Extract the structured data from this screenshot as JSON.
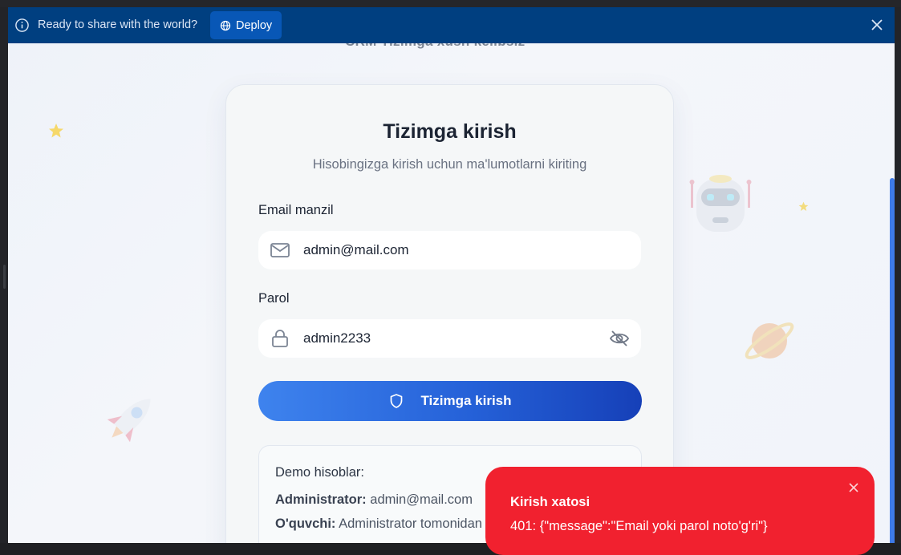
{
  "banner": {
    "text": "Ready to share with the world?",
    "deploy_label": "Deploy",
    "info_icon": "info-icon",
    "close_icon": "close-icon",
    "color": "#003f80"
  },
  "page": {
    "cut_title": "CRM Tizimga xush kelibsiz"
  },
  "login": {
    "title": "Tizimga kirish",
    "subtitle": "Hisobingizga kirish uchun ma'lumotlarni kiriting",
    "email_label": "Email manzil",
    "email_value": "admin@mail.com",
    "password_label": "Parol",
    "password_value": "admin2233",
    "submit_label": "Tizimga kirish",
    "accent_color": "#2561d8"
  },
  "demo": {
    "title": "Demo hisoblar:",
    "rows": [
      {
        "role": "Administrator:",
        "value": "admin@mail.com"
      },
      {
        "role": "O'quvchi:",
        "value": "Administrator tomonidan"
      }
    ]
  },
  "toast": {
    "title": "Kirish xatosi",
    "message": "401: {\"message\":\"Email yoki parol noto'g'ri\"}",
    "color": "#f1212f"
  }
}
